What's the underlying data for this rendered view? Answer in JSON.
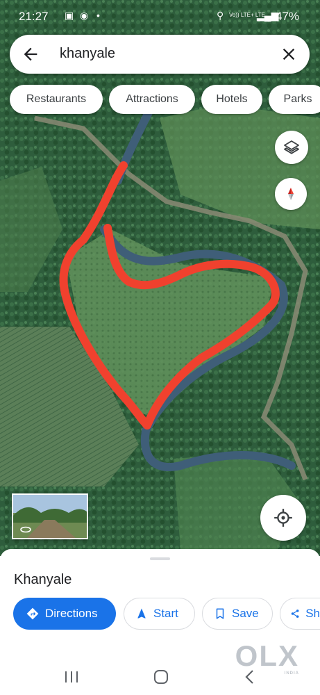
{
  "status_bar": {
    "time": "21:27",
    "network": "Vo)) LTE+ LTE",
    "battery": "47%"
  },
  "search": {
    "query": "khanyale"
  },
  "chips": [
    {
      "label": "Restaurants"
    },
    {
      "label": "Attractions"
    },
    {
      "label": "Hotels"
    },
    {
      "label": "Parks"
    }
  ],
  "map": {
    "view": "satellite",
    "boundary_color": "#f0412e",
    "river_color": "#3f5e78"
  },
  "place": {
    "name": "Khanyale"
  },
  "actions": [
    {
      "label": "Directions",
      "icon": "directions-icon"
    },
    {
      "label": "Start",
      "icon": "navigation-arrow-icon"
    },
    {
      "label": "Save",
      "icon": "bookmark-icon"
    },
    {
      "label": "Sh",
      "icon": "share-icon"
    }
  ],
  "watermark": {
    "brand": "OLX",
    "sub": "INDIA"
  },
  "colors": {
    "accent": "#1a73e8"
  }
}
